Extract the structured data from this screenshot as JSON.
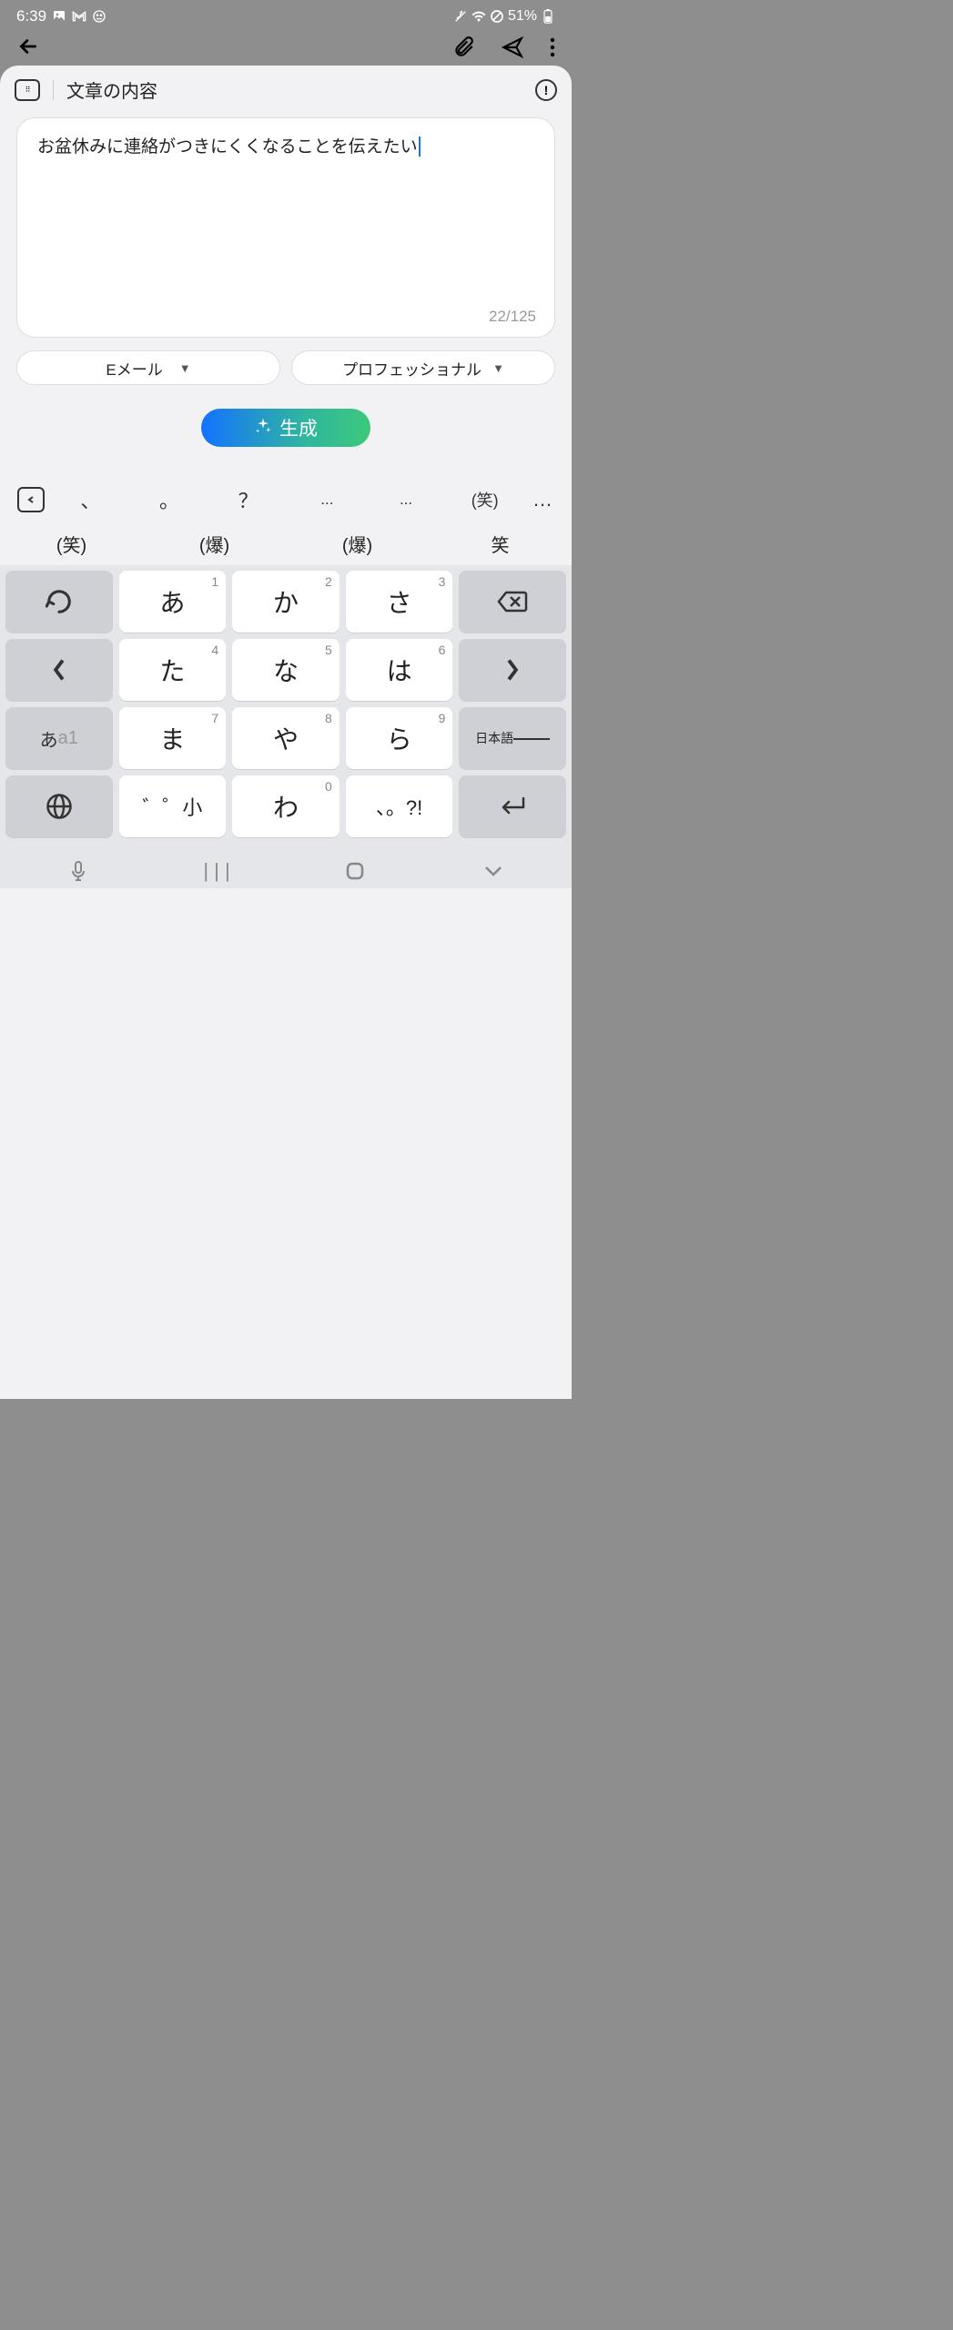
{
  "status": {
    "time": "6:39",
    "battery": "51%"
  },
  "header": {
    "title": "文章の内容"
  },
  "input": {
    "text": "お盆休みに連絡がつきにくくなることを伝えたい",
    "char_count": "22/125"
  },
  "dropdowns": {
    "type": "Eメール",
    "tone": "プロフェッショナル"
  },
  "generate": {
    "label": "生成"
  },
  "keyboard": {
    "top_row": [
      "、",
      "。",
      "？",
      "...",
      "...",
      "(笑)",
      "…"
    ],
    "candidates": [
      "(笑)",
      "(爆)",
      "(爆)",
      "笑"
    ],
    "keys": {
      "r1": [
        {
          "main": "↺",
          "num": ""
        },
        {
          "main": "あ",
          "num": "1"
        },
        {
          "main": "か",
          "num": "2"
        },
        {
          "main": "さ",
          "num": "3"
        },
        {
          "main": "⌫",
          "num": ""
        }
      ],
      "r2": [
        {
          "main": "＜",
          "num": ""
        },
        {
          "main": "た",
          "num": "4"
        },
        {
          "main": "な",
          "num": "5"
        },
        {
          "main": "は",
          "num": "6"
        },
        {
          "main": "＞",
          "num": ""
        }
      ],
      "r3": [
        {
          "main": "あa1",
          "num": ""
        },
        {
          "main": "ま",
          "num": "7"
        },
        {
          "main": "や",
          "num": "8"
        },
        {
          "main": "ら",
          "num": "9"
        },
        {
          "main": "日本語",
          "num": ""
        }
      ],
      "r4": [
        {
          "main": "⊕",
          "num": ""
        },
        {
          "main": "゛゜小",
          "num": ""
        },
        {
          "main": "わ",
          "num": "0"
        },
        {
          "main": "、。?!",
          "num": ""
        },
        {
          "main": "↵",
          "num": ""
        }
      ]
    }
  }
}
